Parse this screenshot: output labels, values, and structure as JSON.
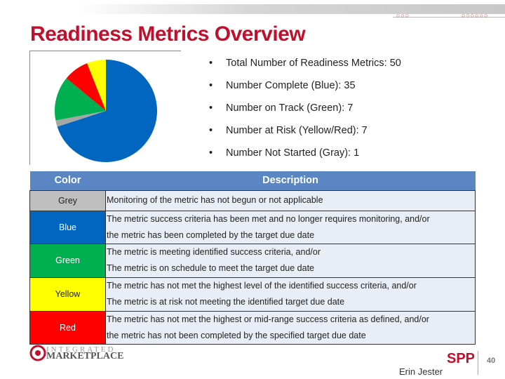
{
  "header": {
    "title": "Readiness Metrics Overview",
    "dots_left": "○○○",
    "dots_right": "○○○○○○"
  },
  "chart_data": {
    "type": "pie",
    "categories": [
      "Blue",
      "Grey",
      "Green",
      "Red",
      "Yellow"
    ],
    "values": [
      35,
      1,
      7,
      4,
      3
    ],
    "colors": [
      "#0066c0",
      "#a6a6a6",
      "#00b050",
      "#ff0000",
      "#ffff00"
    ],
    "start": "12 o'clock",
    "direction": "clockwise"
  },
  "summary": [
    "Total Number of Readiness Metrics: 50",
    "Number Complete (Blue): 35",
    "Number on Track (Green): 7",
    "Number at Risk (Yellow/Red): 7",
    "Number Not Started (Gray): 1"
  ],
  "bullet": "•",
  "table": {
    "headers": [
      "Color",
      "Description"
    ],
    "rows": [
      {
        "color": "Grey",
        "bg": "#bfbfbf",
        "fg": "#222222",
        "lines": [
          "Monitoring of the metric has not begun or not applicable"
        ]
      },
      {
        "color": "Blue",
        "bg": "#0066c0",
        "fg": "#ffffff",
        "lines": [
          "The metric success criteria has been met and no longer requires monitoring, and/or",
          "the metric has been completed by the target due date"
        ]
      },
      {
        "color": "Green",
        "bg": "#00b050",
        "fg": "#ffffff",
        "lines": [
          "The metric is meeting identified success criteria, and/or",
          "The metric is on schedule to meet the target due date"
        ]
      },
      {
        "color": "Yellow",
        "bg": "#ffff00",
        "fg": "#222222",
        "lines": [
          "The metric has not met the highest level of the identified success criteria, and/or",
          "The metric is at risk not meeting the identified target due date"
        ]
      },
      {
        "color": "Red",
        "bg": "#ff0000",
        "fg": "#ffffff",
        "lines": [
          "The metric has not met the highest or mid-range success criteria as defined, and/or",
          "the metric has not been completed by the specified target due date"
        ]
      }
    ]
  },
  "footer": {
    "logo_line1": "INTEGRATED",
    "logo_line2": "MARKETPLACE",
    "spp": "SPP",
    "page": "40",
    "author": "Erin Jester"
  }
}
